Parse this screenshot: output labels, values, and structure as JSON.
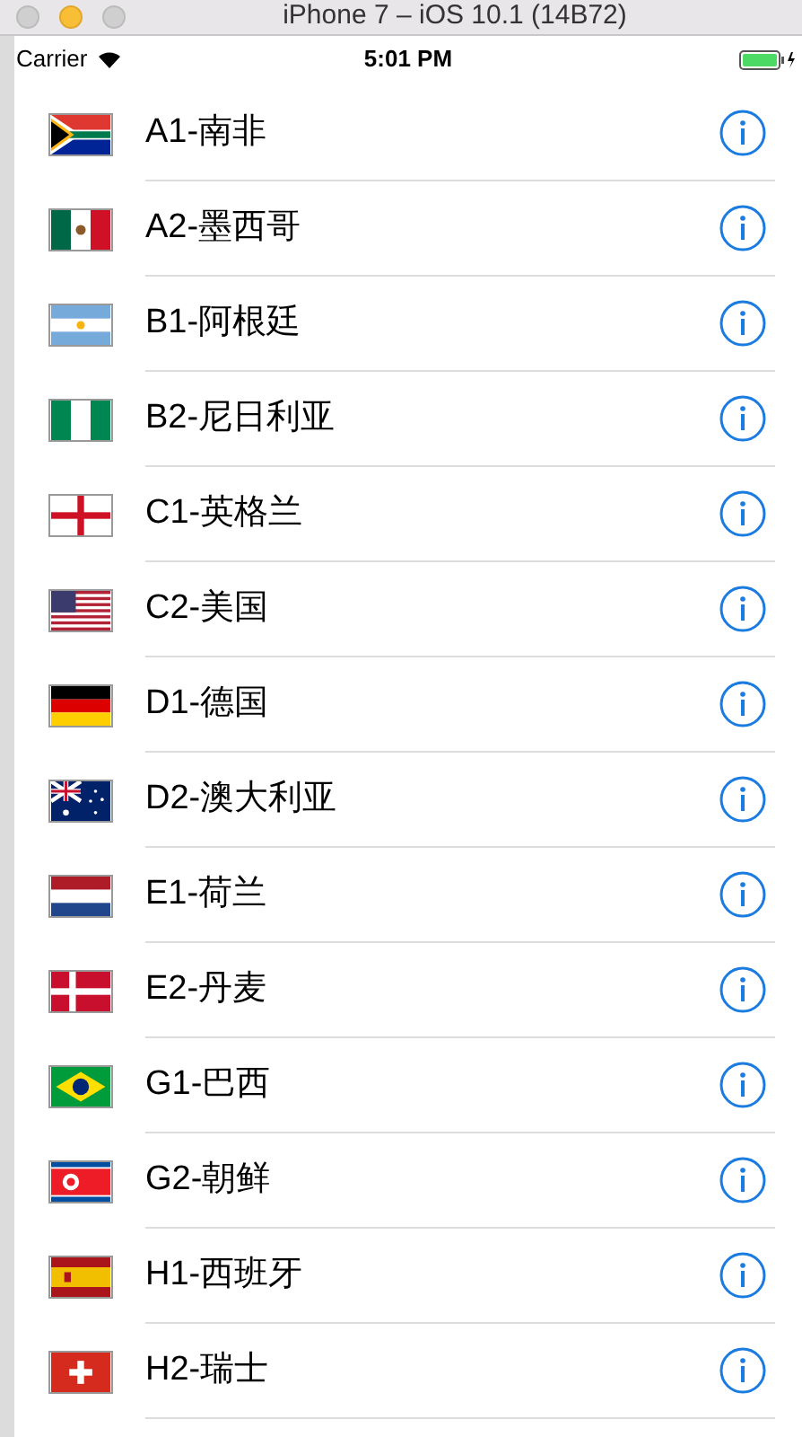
{
  "window": {
    "title": "iPhone 7 – iOS 10.1 (14B72)"
  },
  "status_bar": {
    "carrier": "Carrier",
    "time": "5:01 PM"
  },
  "rows": [
    {
      "label": "A1-南非",
      "kind": "za"
    },
    {
      "label": "A2-墨西哥",
      "kind": "mx"
    },
    {
      "label": "B1-阿根廷",
      "kind": "ar"
    },
    {
      "label": "B2-尼日利亚",
      "kind": "ng"
    },
    {
      "label": "C1-英格兰",
      "kind": "en"
    },
    {
      "label": "C2-美国",
      "kind": "us"
    },
    {
      "label": "D1-德国",
      "kind": "de"
    },
    {
      "label": "D2-澳大利亚",
      "kind": "au"
    },
    {
      "label": "E1-荷兰",
      "kind": "nl"
    },
    {
      "label": "E2-丹麦",
      "kind": "dk"
    },
    {
      "label": "G1-巴西",
      "kind": "br"
    },
    {
      "label": "G2-朝鲜",
      "kind": "kp"
    },
    {
      "label": "H1-西班牙",
      "kind": "es"
    },
    {
      "label": "H2-瑞士",
      "kind": "ch"
    }
  ]
}
